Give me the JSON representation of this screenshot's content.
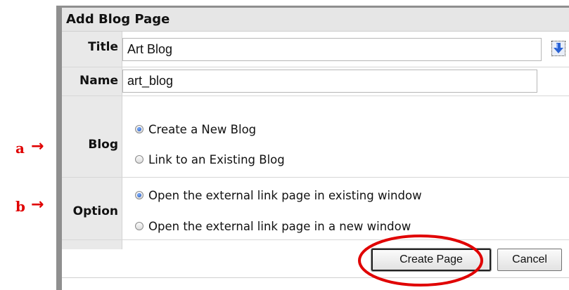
{
  "dialog": {
    "title": "Add Blog Page"
  },
  "form": {
    "title_label": "Title",
    "title_value": "Art Blog",
    "name_label": "Name",
    "name_value": "art_blog",
    "blog_label": "Blog",
    "blog_options": [
      {
        "label": "Create a New Blog",
        "selected": true
      },
      {
        "label": "Link to an Existing Blog",
        "selected": false
      }
    ],
    "option_label": "Option",
    "option_options": [
      {
        "label": "Open the external link page in existing window",
        "selected": true
      },
      {
        "label": "Open the external link page in a new window",
        "selected": false
      }
    ]
  },
  "buttons": {
    "create_label": "Create Page",
    "cancel_label": "Cancel"
  },
  "callouts": {
    "a_label": "a",
    "b_label": "b",
    "arrow_glyph": "→"
  },
  "colors": {
    "annotation_red": "#e00000",
    "radio_selected": "#1d4fb8"
  },
  "icons": {
    "down_arrow": "download-arrow-icon"
  }
}
